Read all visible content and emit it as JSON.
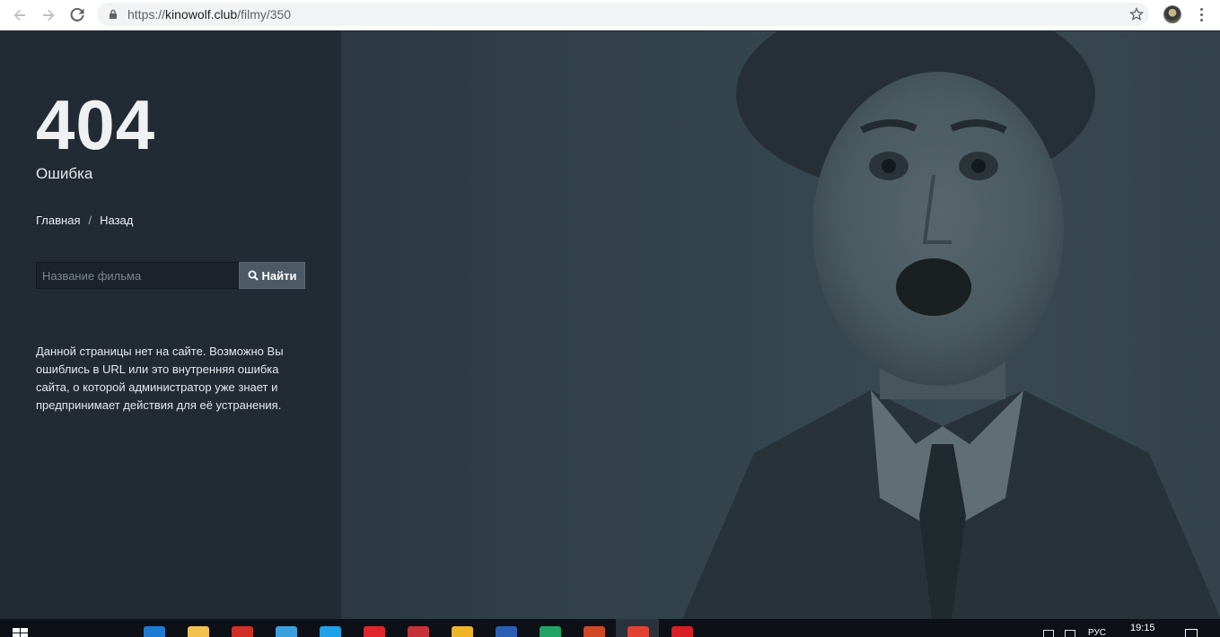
{
  "browser": {
    "url_scheme": "https://",
    "url_host": "kinowolf.club",
    "url_path": "/filmy/350"
  },
  "page": {
    "error_code": "404",
    "error_label": "Ошибка",
    "breadcrumbs": {
      "home": "Главная",
      "separator": "/",
      "back": "Назад"
    },
    "search": {
      "placeholder": "Название фильма",
      "value": "",
      "button_label": "Найти"
    },
    "message": "Данной страницы нет на сайте. Возможно Вы ошиблись в URL или это внутренняя ошибка сайта, о которой администратор уже знает и предпринимает действия для её устранения."
  },
  "taskbar": {
    "language": "РУС",
    "time": "19:15",
    "apps": [
      {
        "name": "edge-icon",
        "color": "#1e7bd4"
      },
      {
        "name": "explorer-icon",
        "color": "#f2c14e"
      },
      {
        "name": "settings-app-icon",
        "color": "#d22f27"
      },
      {
        "name": "app-x-icon",
        "color": "#3aa0e0"
      },
      {
        "name": "skype-icon",
        "color": "#1ea1e6"
      },
      {
        "name": "opera-icon",
        "color": "#e0262c"
      },
      {
        "name": "app-red-icon",
        "color": "#c7313a"
      },
      {
        "name": "app-yellow-icon",
        "color": "#f0b429"
      },
      {
        "name": "word-icon",
        "color": "#2b5fb3"
      },
      {
        "name": "excel-icon",
        "color": "#21a366"
      },
      {
        "name": "powerpoint-icon",
        "color": "#d24726"
      },
      {
        "name": "chrome-icon",
        "color": "#e34133"
      },
      {
        "name": "app-5-icon",
        "color": "#d91f26"
      }
    ]
  },
  "colors": {
    "left_panel": "#222a33",
    "hero_overlay": "#33434c",
    "accent_button": "#4d5a66"
  }
}
